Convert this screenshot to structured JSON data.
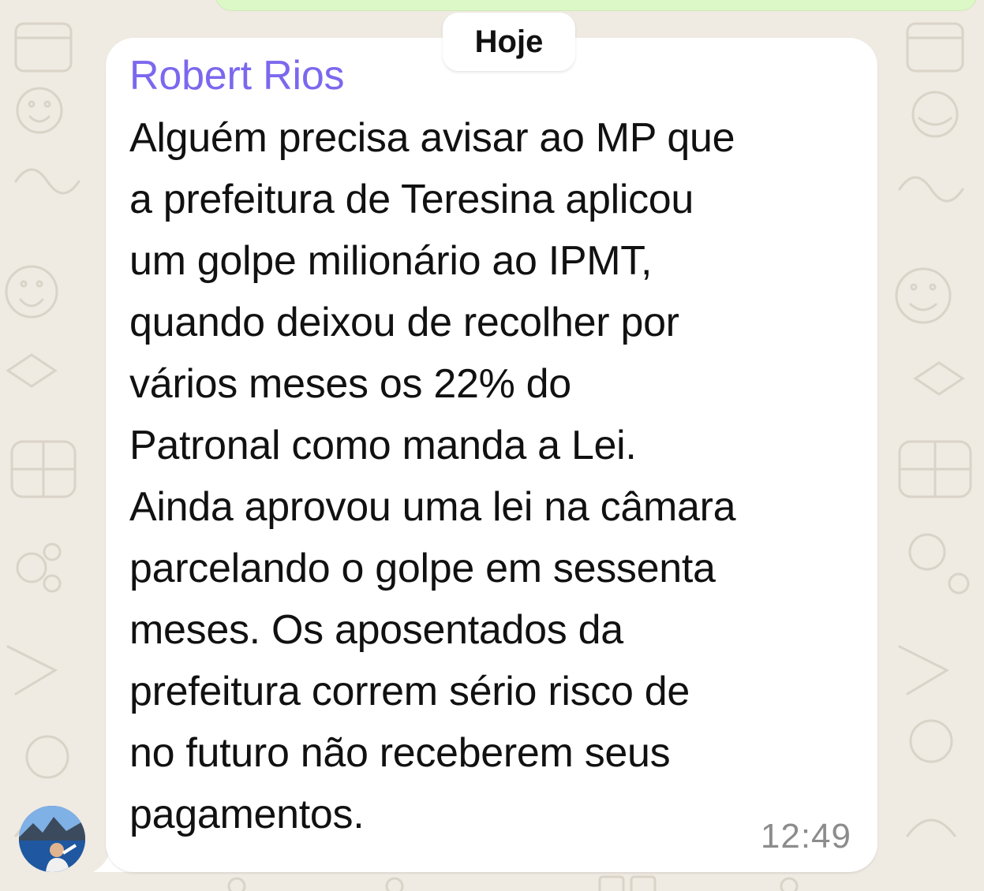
{
  "date_separator": "Hoje",
  "message": {
    "sender": "Robert Rios",
    "sender_color": "#7b68ee",
    "text": "Alguém precisa avisar ao MP que\na prefeitura de Teresina aplicou\num golpe milionário ao IPMT,\nquando deixou de recolher por\nvários meses os 22% do\nPatronal como manda a Lei.\nAinda aprovou uma lei na câmara\nparcelando o golpe em sessenta\nmeses. Os aposentados da\nprefeitura correm sério risco de\nno futuro não receberem seus\npagamentos.",
    "time": "12:49"
  },
  "colors": {
    "chat_background": "#efeae2",
    "bubble": "#ffffff",
    "outgoing_bubble": "#dcf8c6",
    "time_text": "#8c8c8c"
  }
}
